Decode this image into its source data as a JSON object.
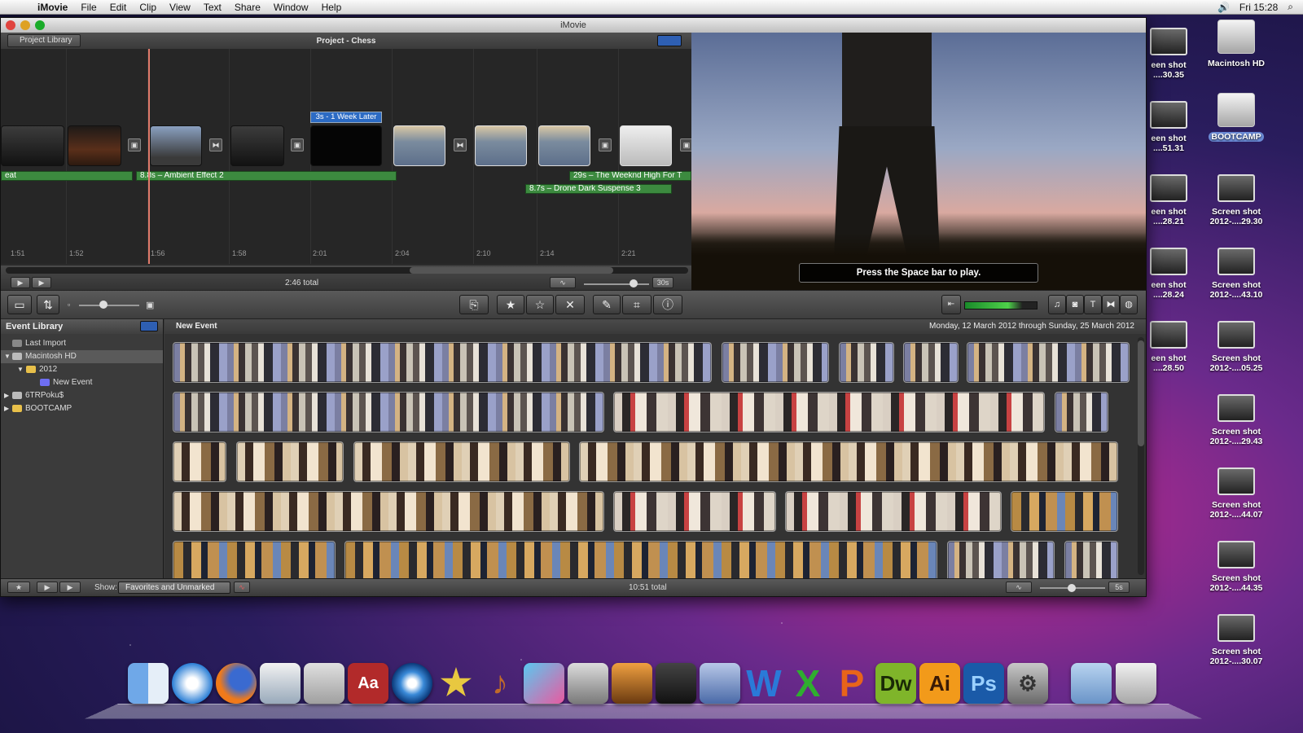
{
  "menubar": {
    "app": "iMovie",
    "items": [
      "File",
      "Edit",
      "Clip",
      "View",
      "Text",
      "Share",
      "Window",
      "Help"
    ],
    "clock": "Fri 15:28"
  },
  "window": {
    "title": "iMovie"
  },
  "project": {
    "back_label": "Project Library",
    "title": "Project - Chess",
    "title_clip": "3s - 1 Week Later",
    "audio": [
      {
        "label": "eat"
      },
      {
        "label": "8.8s – Ambient Effect 2"
      },
      {
        "label": "29s – The Weeknd High For T"
      },
      {
        "label": "8.7s – Drone Dark Suspense 3"
      }
    ],
    "ticks": [
      "1:51",
      "1:52",
      "1:56",
      "1:58",
      "2:01",
      "2:04",
      "2:10",
      "2:14",
      "2:21"
    ],
    "total": "2:46 total",
    "zoom_label": "30s"
  },
  "viewer": {
    "message": "Press the Space bar to play."
  },
  "library": {
    "title": "Event Library",
    "items": [
      {
        "label": "Last Import"
      },
      {
        "label": "Macintosh HD"
      },
      {
        "label": "2012"
      },
      {
        "label": "New Event"
      },
      {
        "label": "6TRPoku$"
      },
      {
        "label": "BOOTCAMP"
      }
    ]
  },
  "browser": {
    "event_title": "New Event",
    "date_range": "Monday, 12 March 2012 through Sunday, 25 March 2012"
  },
  "status": {
    "show_label": "Show:",
    "show_value": "Favorites and Unmarked",
    "total": "10:51 total",
    "zoom_label": "5s"
  },
  "desktop": {
    "icons": [
      {
        "line1": "Macintosh HD",
        "line2": ""
      },
      {
        "line1": "BOOTCAMP",
        "line2": ""
      },
      {
        "line1": "Screen shot",
        "line2": "2012-....29.30"
      },
      {
        "line1": "Screen shot",
        "line2": "2012-....43.10"
      },
      {
        "line1": "Screen shot",
        "line2": "2012-....05.25"
      },
      {
        "line1": "Screen shot",
        "line2": "2012-....29.43"
      },
      {
        "line1": "Screen shot",
        "line2": "2012-....44.07"
      },
      {
        "line1": "Screen shot",
        "line2": "2012-....44.35"
      },
      {
        "line1": "Screen shot",
        "line2": "2012-....30.07"
      }
    ],
    "left_col": [
      {
        "line1": "een shot",
        "line2": "....30.35"
      },
      {
        "line1": "een shot",
        "line2": "....51.31"
      },
      {
        "line1": "een shot",
        "line2": "....28.21"
      },
      {
        "line1": "een shot",
        "line2": "....28.24"
      },
      {
        "line1": "een shot",
        "line2": "....28.50"
      }
    ]
  },
  "dock": {
    "apps": [
      "Finder",
      "Safari",
      "Firefox",
      "Preview",
      "Calculator",
      "Dictionary",
      "DVD Player",
      "iMovie",
      "GarageBand",
      "iTunes",
      "Disk Utility",
      "Migration Assistant",
      "Final Cut",
      "Network",
      "Word",
      "Excel",
      "PowerPoint",
      "Dreamweaver",
      "Illustrator",
      "Photoshop",
      "System Preferences",
      "Documents",
      "Trash"
    ],
    "labels": {
      "word": "W",
      "excel": "X",
      "ppt": "P",
      "dw": "Dw",
      "ai": "Ai",
      "ps": "Ps",
      "dict": "Aa"
    }
  },
  "colors": {
    "accent": "#2e5fb3",
    "audio_clip": "#3c8a3f",
    "playhead": "#e07a6a"
  }
}
